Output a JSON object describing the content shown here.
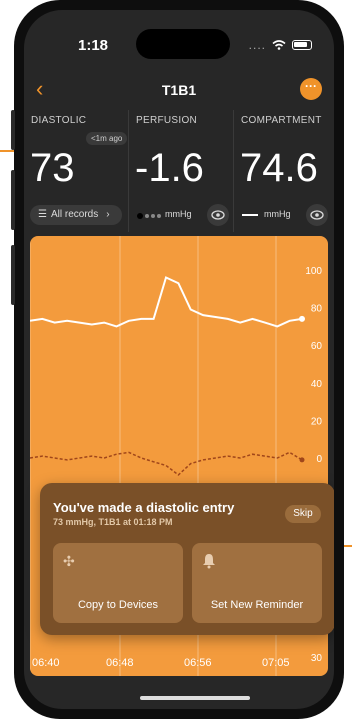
{
  "status_bar": {
    "time": "1:18"
  },
  "nav": {
    "title": "T1B1",
    "back_icon": "chevron-left-icon",
    "more_icon": "more-icon"
  },
  "metrics": [
    {
      "label": "DIASTOLIC",
      "value": "73",
      "badge": "<1m ago",
      "records_label": "All records"
    },
    {
      "label": "PERFUSION",
      "value": "-1.6",
      "unit": "mmHg"
    },
    {
      "label": "COMPARTMENT",
      "value": "74.6",
      "unit": "mmHg"
    }
  ],
  "colors": {
    "accent": "#f0932a",
    "chart_bg": "#f39b3d",
    "popup_bg": "#7a5028"
  },
  "chart_data": {
    "type": "line",
    "x_ticks": [
      "06:40",
      "06:48",
      "06:56",
      "07:05"
    ],
    "y_ticks_upper": [
      100,
      80,
      60,
      40,
      20,
      0
    ],
    "y_ticks_lower": [
      30,
      0
    ],
    "series": [
      {
        "values": [
          73,
          74,
          72,
          73,
          72,
          71,
          72,
          70,
          73,
          74,
          74,
          96,
          93,
          79,
          76,
          75,
          74,
          72,
          74,
          72,
          70,
          73,
          74
        ]
      },
      {
        "values": [
          0,
          1,
          0,
          -1,
          0,
          1,
          0,
          2,
          3,
          0,
          -2,
          -4,
          -9,
          -3,
          -1,
          0,
          1,
          0,
          2,
          1,
          0,
          3,
          -1
        ]
      }
    ]
  },
  "popup": {
    "title": "You've made a diastolic entry",
    "subtitle": "73 mmHg, T1B1 at 01:18 PM",
    "skip_label": "Skip",
    "actions": [
      {
        "label": "Copy to Devices",
        "icon": "share-icon"
      },
      {
        "label": "Set New Reminder",
        "icon": "bell-icon"
      }
    ]
  }
}
